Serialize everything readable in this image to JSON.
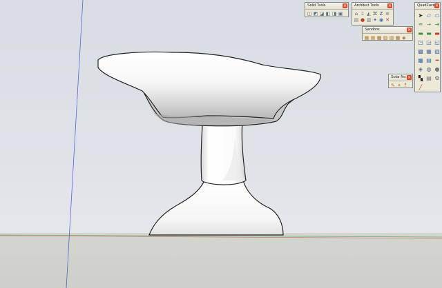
{
  "palettes": {
    "solid_tools": {
      "title": "Solid Tools",
      "tools": [
        {
          "icon": "outer-shell-icon",
          "glyph": "◫",
          "color": "#5a6b7d"
        },
        {
          "icon": "intersect-icon",
          "glyph": "◩",
          "color": "#4f6f8f"
        },
        {
          "icon": "union-icon",
          "glyph": "◪",
          "color": "#4f6f8f"
        },
        {
          "icon": "subtract-icon",
          "glyph": "◧",
          "color": "#4f6f8f"
        },
        {
          "icon": "trim-icon",
          "glyph": "◨",
          "color": "#4f6f8f"
        },
        {
          "icon": "split-icon",
          "glyph": "▣",
          "color": "#4f6f8f"
        }
      ]
    },
    "architect_tools": {
      "title": "Architect Tools",
      "tools": [
        {
          "icon": "fence-icon",
          "glyph": "⌂",
          "color": "#5b6b6f"
        },
        {
          "icon": "stair-icon",
          "glyph": "⌶",
          "color": "#5b6b6f"
        },
        {
          "icon": "roof-icon",
          "glyph": "◭",
          "color": "#5b6b6f"
        },
        {
          "icon": "building-icon",
          "glyph": "⌘",
          "color": "#5b6b6f"
        },
        {
          "icon": "z-axis-icon",
          "glyph": "Z",
          "color": "#2c3e8c"
        },
        {
          "icon": "level-icon",
          "glyph": "≡",
          "color": "#5b6b6f"
        },
        {
          "icon": "window-icon",
          "glyph": "▤",
          "color": "#6e7a80"
        },
        {
          "icon": "red-tool-icon",
          "glyph": "●",
          "color": "#c03a2b"
        },
        {
          "icon": "door-icon",
          "glyph": "▥",
          "color": "#6e7a80"
        },
        {
          "icon": "magic-icon",
          "glyph": "✦",
          "color": "#3a6cb0"
        },
        {
          "icon": "eye-icon",
          "glyph": "◉",
          "color": "#3a6cb0"
        },
        {
          "icon": "warning-icon",
          "glyph": "✕",
          "color": "#c03a2b"
        }
      ]
    },
    "sandbox": {
      "title": "Sandbox",
      "tools": [
        {
          "icon": "from-contours-icon",
          "glyph": "▦",
          "color": "#b07a30"
        },
        {
          "icon": "from-scratch-icon",
          "glyph": "▦",
          "color": "#c08a3a"
        },
        {
          "icon": "smoove-icon",
          "glyph": "▩",
          "color": "#a56f2a"
        },
        {
          "icon": "stamp-icon",
          "glyph": "▨",
          "color": "#b07a30"
        },
        {
          "icon": "drape-icon",
          "glyph": "▧",
          "color": "#b07a30"
        },
        {
          "icon": "add-detail-icon",
          "glyph": "▦",
          "color": "#a56f2a"
        },
        {
          "icon": "flip-edge-icon",
          "glyph": "◈",
          "color": "#8c6a30"
        }
      ]
    },
    "solar_north": {
      "title": "Solar No...",
      "tools": [
        {
          "icon": "north-toggle-icon",
          "glyph": "✎",
          "color": "#b07a30"
        },
        {
          "icon": "north-arrow-icon",
          "glyph": "✴",
          "color": "#b08a20"
        },
        {
          "icon": "enter-north-icon",
          "glyph": "⇡",
          "color": "#a05020"
        }
      ]
    },
    "quadface": {
      "title": "QuadFace...",
      "tools": [
        {
          "icon": "select-quad-icon",
          "glyph": "➤",
          "color": "#222"
        },
        {
          "icon": "select-ring-icon",
          "glyph": "▱",
          "color": "#4a6fa5"
        },
        {
          "icon": "select-loop-icon",
          "glyph": "▭",
          "color": "#4a6fa5"
        },
        {
          "icon": "grow-selection-icon",
          "glyph": "═",
          "color": "#3f8f3f"
        },
        {
          "icon": "shrink-selection-icon",
          "glyph": "⇢",
          "color": "#3f8f3f"
        },
        {
          "icon": "select-edges-icon",
          "glyph": "⇥",
          "color": "#3f8f3f"
        },
        {
          "icon": "connect-icon",
          "glyph": "▬",
          "color": "#3f8f3f"
        },
        {
          "icon": "insert-loop-icon",
          "glyph": "▬",
          "color": "#3f8f3f"
        },
        {
          "icon": "remove-loop-icon",
          "glyph": "▬",
          "color": "#c03a2b"
        },
        {
          "icon": "build-corners-icon",
          "glyph": "◳",
          "color": "#3a6cb0"
        },
        {
          "icon": "build-ends-icon",
          "glyph": "◲",
          "color": "#3a6cb0"
        },
        {
          "icon": "flatten-icon",
          "glyph": "◱",
          "color": "#3a6cb0"
        },
        {
          "icon": "offset-loop-icon",
          "glyph": "▩",
          "color": "#4a6fa5"
        },
        {
          "icon": "smooth-quads-icon",
          "glyph": "▦",
          "color": "#4a6fa5"
        },
        {
          "icon": "wrap-icon",
          "glyph": "▧",
          "color": "#4a6fa5"
        },
        {
          "icon": "uv-map-icon",
          "glyph": "▦",
          "color": "#3a6cb0"
        },
        {
          "icon": "uv-mapping-icon",
          "glyph": "▤",
          "color": "#3a6cb0"
        },
        {
          "icon": "line-icon",
          "glyph": "━",
          "color": "#c03a2b"
        },
        {
          "icon": "mesh-icon",
          "glyph": "◈",
          "color": "#5a6b7d"
        },
        {
          "icon": "lock-icon",
          "glyph": "◍",
          "color": "#5a6b7d"
        },
        {
          "icon": "sphere-icon",
          "glyph": "●",
          "color": "#777"
        },
        {
          "icon": "checker-icon",
          "glyph": "▚",
          "color": "#222"
        },
        {
          "icon": "triangulate-icon",
          "glyph": "▤",
          "color": "#6a6a6a"
        },
        {
          "icon": "gear-icon",
          "glyph": "⚙",
          "color": "#6a6a6a"
        },
        {
          "icon": "pencil-icon",
          "glyph": "╱",
          "color": "#c03a2b"
        }
      ]
    }
  }
}
